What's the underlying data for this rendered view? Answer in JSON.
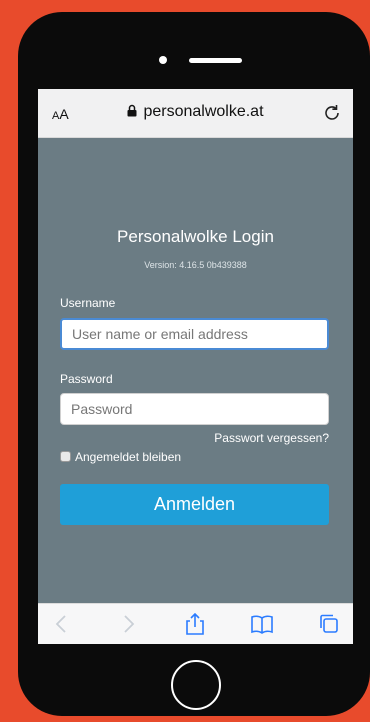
{
  "browser": {
    "text_size_label_small": "A",
    "text_size_label_large": "A",
    "url": "personalwolke.at"
  },
  "login": {
    "title": "Personalwolke Login",
    "version": "Version: 4.16.5 0b439388",
    "username_label": "Username",
    "username_placeholder": "User name or email address",
    "password_label": "Password",
    "password_placeholder": "Password",
    "forgot_password": "Passwort vergessen?",
    "remember_me": "Angemeldet bleiben",
    "submit": "Anmelden"
  },
  "colors": {
    "frame": "#e84b2c",
    "screen_bg": "#6b7c84",
    "button": "#1f9fd8",
    "toolbar_icon": "#2b7cff"
  },
  "toolbar": {
    "icons": [
      "back-icon",
      "forward-icon",
      "share-icon",
      "bookmarks-icon",
      "tabs-icon"
    ]
  }
}
